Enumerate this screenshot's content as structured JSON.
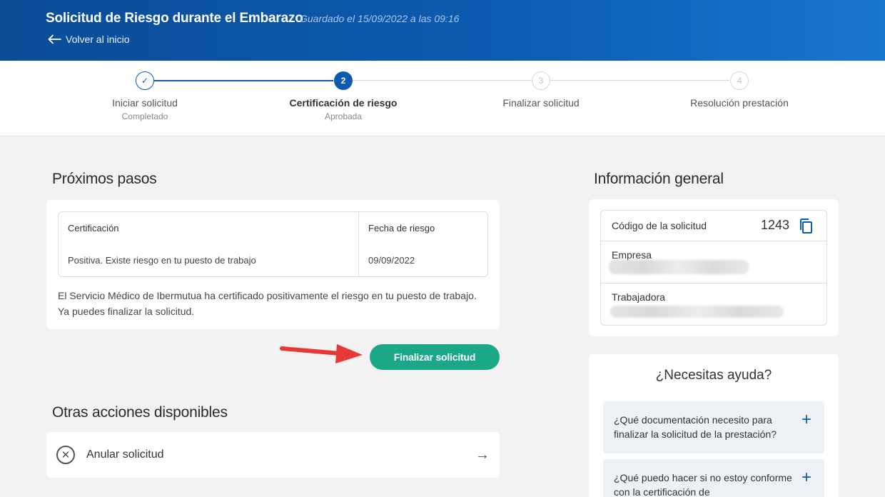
{
  "header": {
    "title": "Solicitud de Riesgo durante el Embarazo",
    "saved": "Guardado el 15/09/2022 a las 09:16",
    "back_label": "Volver al inicio"
  },
  "stepper": {
    "steps": [
      {
        "label": "Iniciar solicitud",
        "sub": "Completado",
        "status": "done",
        "number": "✓"
      },
      {
        "label": "Certificación de riesgo",
        "sub": "Aprobada",
        "status": "current",
        "number": "2"
      },
      {
        "label": "Finalizar solicitud",
        "sub": "",
        "status": "todo",
        "number": "3"
      },
      {
        "label": "Resolución prestación",
        "sub": "",
        "status": "todo",
        "number": "4"
      }
    ]
  },
  "next_steps": {
    "title": "Próximos pasos",
    "table": {
      "headers": [
        "Certificación",
        "Fecha de riesgo"
      ],
      "rows": [
        [
          "Positiva. Existe riesgo en tu puesto de trabajo",
          "09/09/2022"
        ]
      ]
    },
    "note": "El Servicio Médico de Ibermutua ha certificado positivamente el riesgo en tu puesto de trabajo. Ya puedes finalizar la solicitud.",
    "primary_button": "Finalizar solicitud"
  },
  "other_actions": {
    "title": "Otras acciones disponibles",
    "items": [
      {
        "label": "Anular solicitud",
        "icon": "cancel-circle-icon"
      }
    ]
  },
  "general_info": {
    "title": "Información general",
    "code_label": "Código de la solicitud",
    "code_value": "1243",
    "company_label": "Empresa",
    "worker_label": "Trabajadora"
  },
  "help": {
    "title": "¿Necesitas ayuda?",
    "faqs": [
      {
        "question": "¿Qué documentación necesito para finalizar la solicitud de la prestación?"
      },
      {
        "question": "¿Qué puedo hacer si no estoy conforme con la certificación de"
      }
    ]
  },
  "colors": {
    "header_blue": "#0c5bb0",
    "primary_green": "#1aa888",
    "annotation_red": "#e53935"
  }
}
